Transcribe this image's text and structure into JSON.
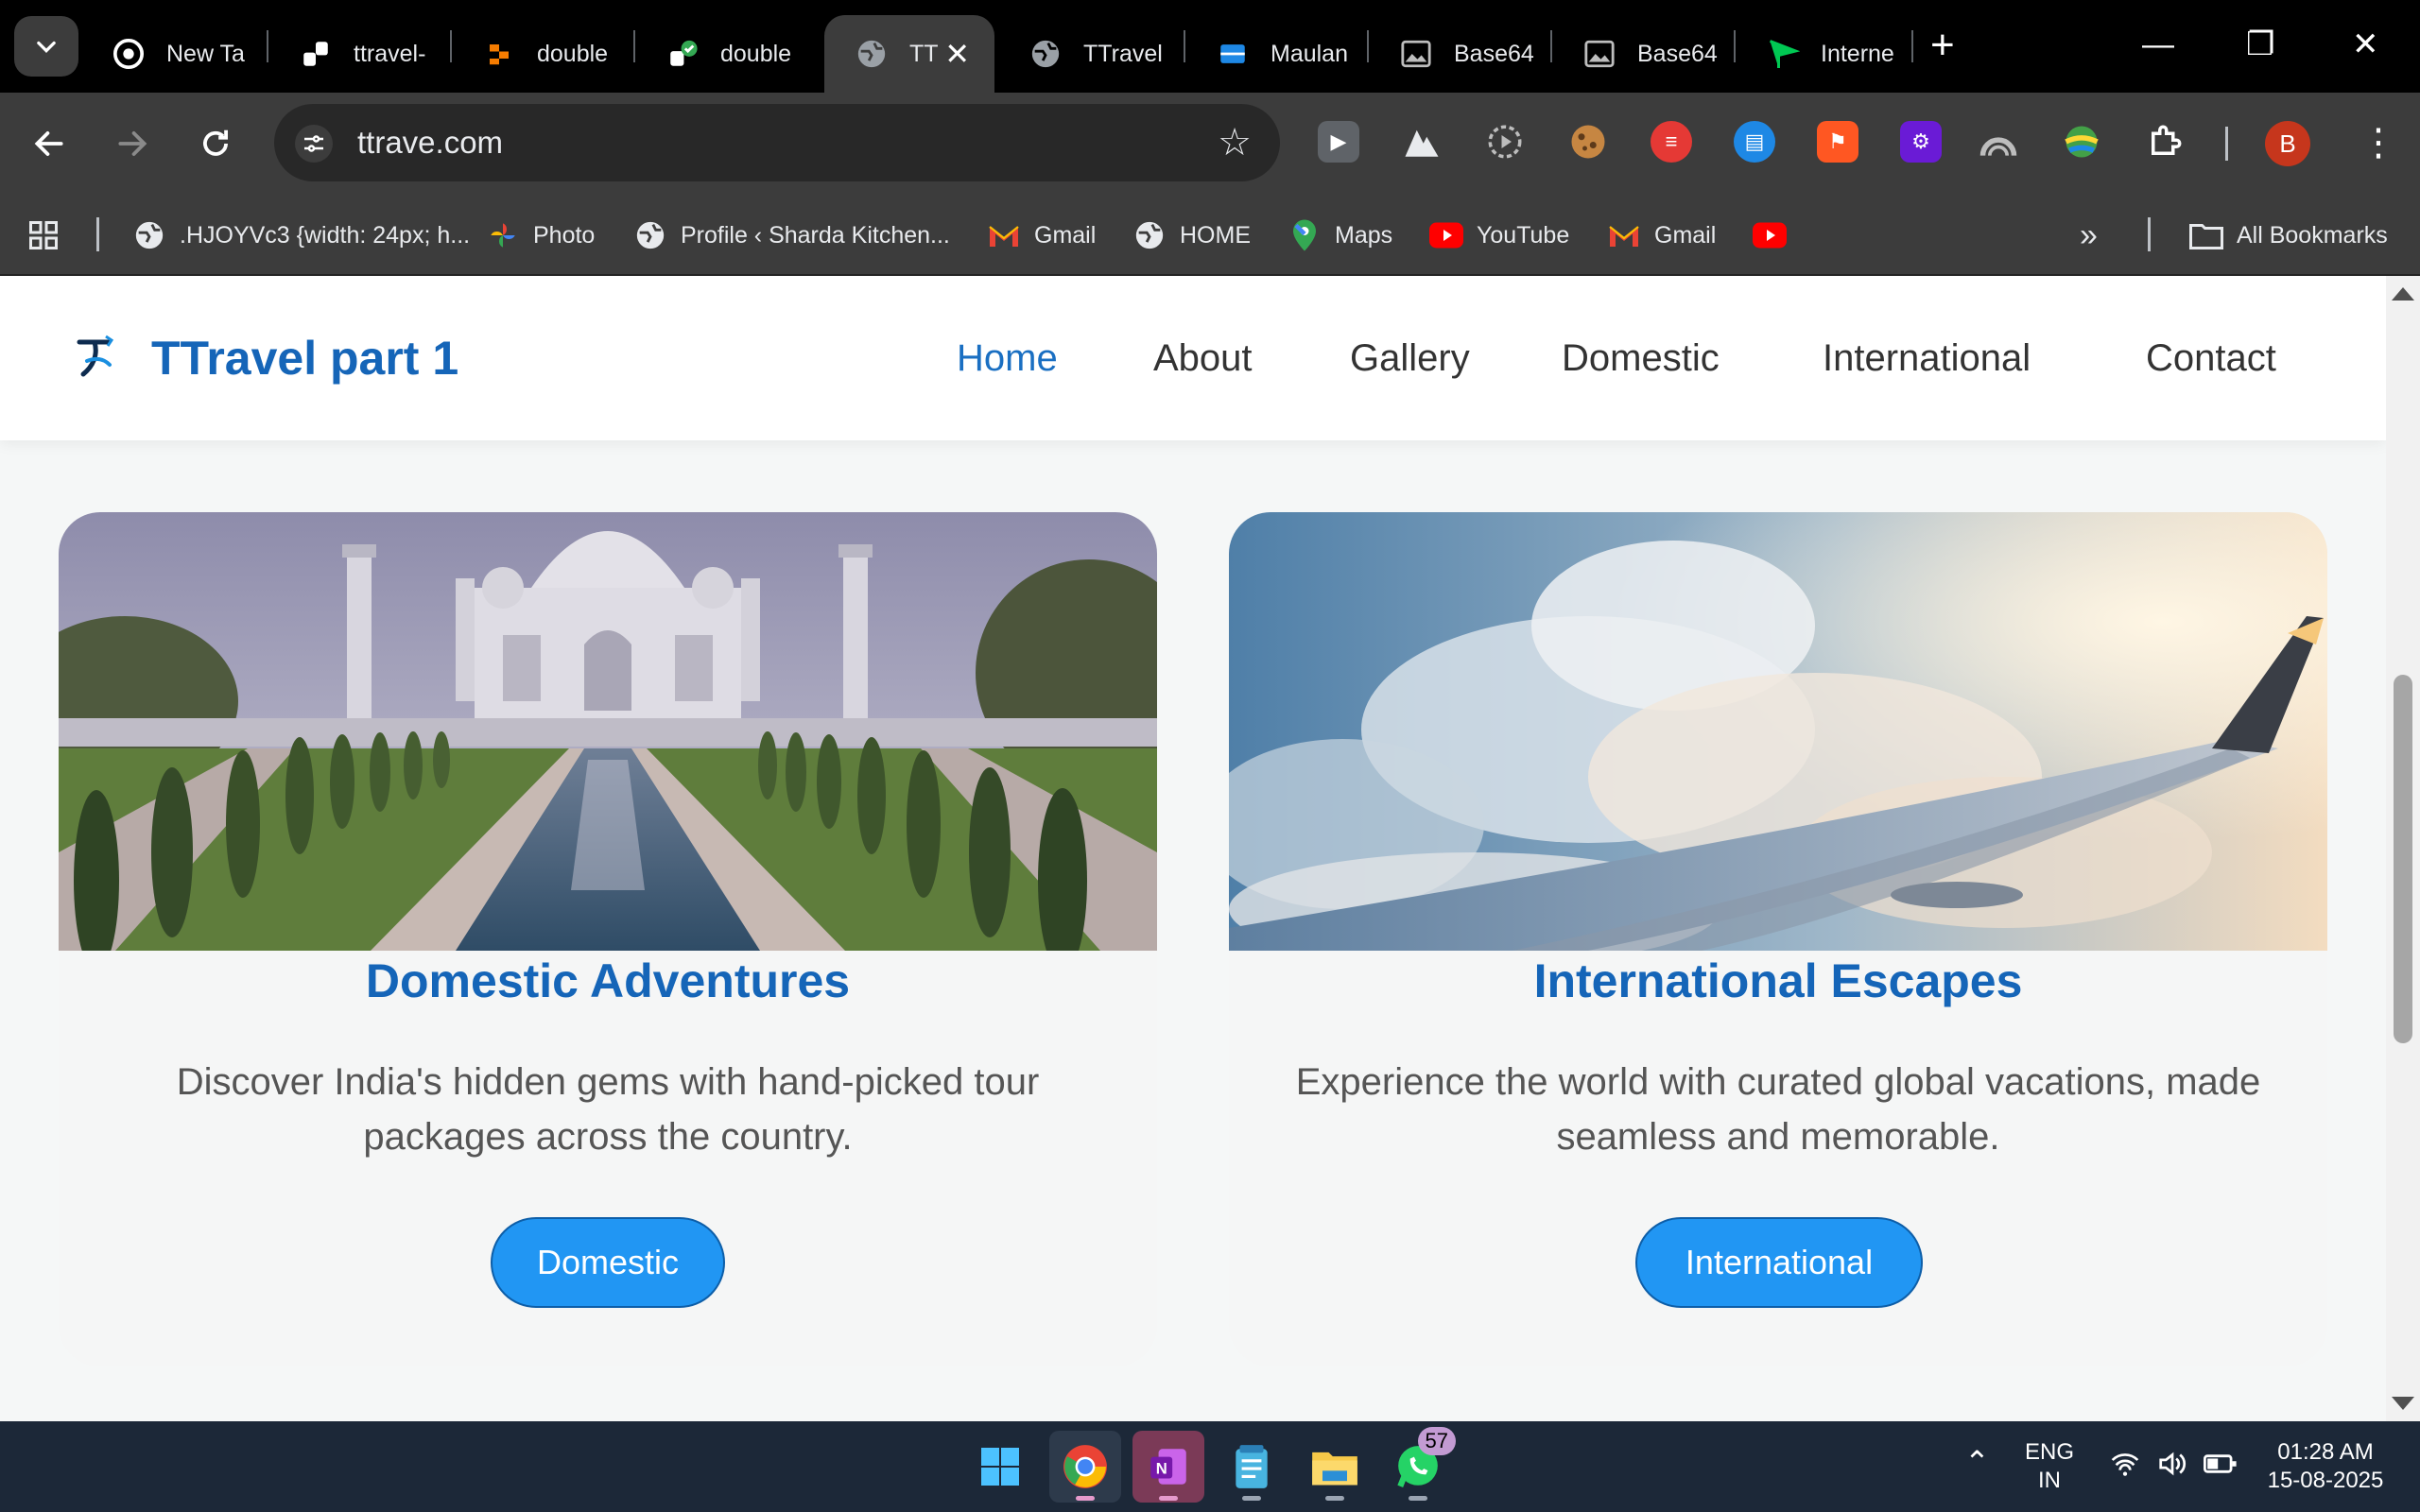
{
  "browser": {
    "tabs": [
      {
        "title": "New Ta",
        "active": false
      },
      {
        "title": "ttravel-",
        "active": false
      },
      {
        "title": "double",
        "active": false
      },
      {
        "title": "double",
        "active": false
      },
      {
        "title": "TT",
        "active": true
      },
      {
        "title": "TTravel",
        "active": false
      },
      {
        "title": "Maulan",
        "active": false
      },
      {
        "title": "Base64",
        "active": false
      },
      {
        "title": "Base64",
        "active": false
      },
      {
        "title": "Interne",
        "active": false
      }
    ],
    "new_tab": "+",
    "close_tab": "✕",
    "window_controls": {
      "minimize": "—",
      "restore": "❐",
      "close": "✕"
    },
    "url": "ttrave.com",
    "profile_initial": "B",
    "bookmarks": [
      {
        "label": ".HJOYVc3 {width: 24px; h..."
      },
      {
        "label": "Photo"
      },
      {
        "label": "Profile ‹ Sharda Kitchen..."
      },
      {
        "label": "Gmail"
      },
      {
        "label": "HOME"
      },
      {
        "label": "Maps"
      },
      {
        "label": "YouTube"
      },
      {
        "label": "Gmail"
      },
      {
        "label": ""
      }
    ],
    "more_bookmarks": "»",
    "all_bookmarks": "All Bookmarks"
  },
  "site": {
    "title": "TTravel part 1",
    "nav": [
      "Home",
      "About",
      "Gallery",
      "Domestic",
      "International",
      "Contact"
    ],
    "cards": [
      {
        "title": "Domestic Adventures",
        "text": "Discover India's hidden gems with hand-picked tour packages across the country.",
        "button": "Domestic"
      },
      {
        "title": "International Escapes",
        "text": "Experience the world with curated global vacations, made seamless and memorable.",
        "button": "International"
      }
    ]
  },
  "taskbar": {
    "whatsapp_badge": "57",
    "language": "ENG",
    "region": "IN",
    "time": "01:28 AM",
    "date": "15-08-2025"
  },
  "colors": {
    "brand": "#1565b8",
    "button": "#2196f3",
    "profile": "#c6361c"
  }
}
